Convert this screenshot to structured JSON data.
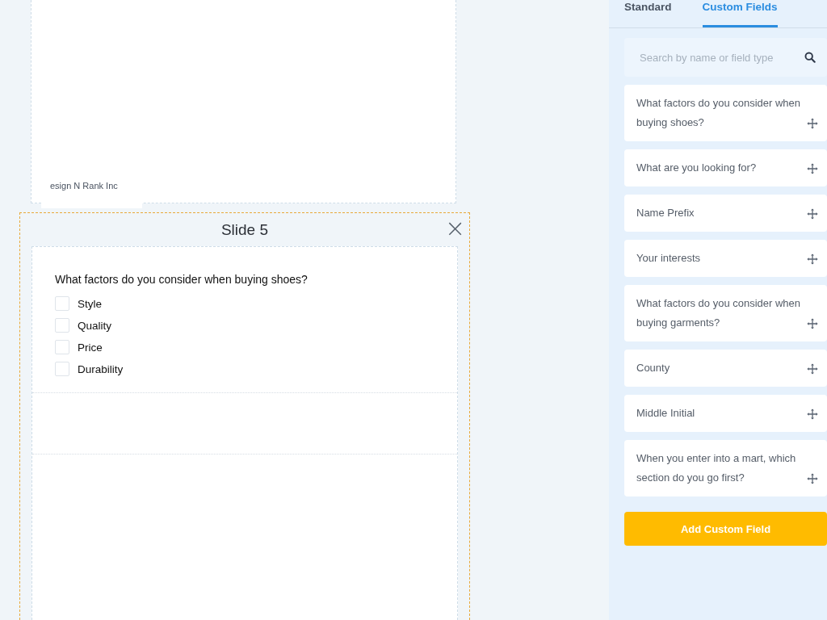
{
  "previous_slide": {
    "footer": "esign N Rank Inc"
  },
  "slide": {
    "title": "Slide 5",
    "close": "×",
    "question": "What factors do you consider when buying shoes?",
    "options": [
      {
        "label": "Style",
        "checked": false
      },
      {
        "label": "Quality",
        "checked": false
      },
      {
        "label": "Price",
        "checked": false
      },
      {
        "label": "Durability",
        "checked": false
      }
    ]
  },
  "panel": {
    "tabs": [
      {
        "label": "Standard",
        "selected": false
      },
      {
        "label": "Custom Fields",
        "selected": true
      }
    ],
    "search": {
      "placeholder": "Search by name or field type"
    },
    "fields": [
      {
        "label": "What factors do you consider when buying shoes?"
      },
      {
        "label": "What are you looking for?"
      },
      {
        "label": "Name Prefix"
      },
      {
        "label": "Your interests"
      },
      {
        "label": "What factors do you consider when buying garments?"
      },
      {
        "label": "County"
      },
      {
        "label": "Middle Initial"
      },
      {
        "label": "When you enter into a mart, which section do you go first?"
      }
    ],
    "add_button": "Add Custom Field"
  }
}
